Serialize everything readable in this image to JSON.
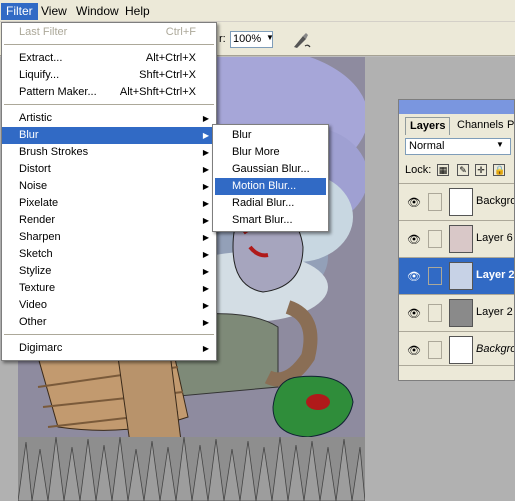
{
  "menubar": {
    "items": [
      {
        "label": "Filter",
        "active": true
      },
      {
        "label": "View"
      },
      {
        "label": "Window"
      },
      {
        "label": "Help"
      }
    ]
  },
  "options_bar": {
    "zoom_label": "r:",
    "zoom_value": "100%",
    "zoom_arrow": "▼"
  },
  "filter_menu": {
    "last_filter": {
      "label": "Last Filter",
      "shortcut": "Ctrl+F"
    },
    "group1": [
      {
        "label": "Extract...",
        "shortcut": "Alt+Ctrl+X"
      },
      {
        "label": "Liquify...",
        "shortcut": "Shft+Ctrl+X"
      },
      {
        "label": "Pattern Maker...",
        "shortcut": "Alt+Shft+Ctrl+X"
      }
    ],
    "categories": [
      {
        "label": "Artistic",
        "arrow": "▶"
      },
      {
        "label": "Blur",
        "arrow": "▶"
      },
      {
        "label": "Brush Strokes",
        "arrow": "▶"
      },
      {
        "label": "Distort",
        "arrow": "▶"
      },
      {
        "label": "Noise",
        "arrow": "▶"
      },
      {
        "label": "Pixelate",
        "arrow": "▶"
      },
      {
        "label": "Render",
        "arrow": "▶"
      },
      {
        "label": "Sharpen",
        "arrow": "▶"
      },
      {
        "label": "Sketch",
        "arrow": "▶"
      },
      {
        "label": "Stylize",
        "arrow": "▶"
      },
      {
        "label": "Texture",
        "arrow": "▶"
      },
      {
        "label": "Video",
        "arrow": "▶"
      },
      {
        "label": "Other",
        "arrow": "▶"
      }
    ],
    "plugins": [
      {
        "label": "Digimarc",
        "arrow": "▶"
      }
    ],
    "highlighted": "Blur"
  },
  "blur_submenu": {
    "items": [
      "Blur",
      "Blur More",
      "Gaussian Blur...",
      "Motion Blur...",
      "Radial Blur...",
      "Smart Blur..."
    ],
    "highlighted": "Motion Blur..."
  },
  "layers_panel": {
    "tabs": [
      "Layers",
      "Channels",
      "Pa"
    ],
    "blend_mode": "Normal",
    "blend_arrow": "▼",
    "lock_label": "Lock:",
    "lock_icons": [
      "▦",
      "✎",
      "✛",
      "🔒"
    ],
    "layers": [
      {
        "name": "Backgrou",
        "eye": "👁",
        "selected": false,
        "italic": false
      },
      {
        "name": "Layer 6",
        "eye": "👁",
        "selected": false,
        "italic": false
      },
      {
        "name": "Layer 2",
        "eye": "👁",
        "selected": true,
        "italic": false
      },
      {
        "name": "Layer 2",
        "eye": "👁",
        "selected": false,
        "italic": false
      },
      {
        "name": "Backgrou",
        "eye": "👁",
        "selected": false,
        "italic": true
      }
    ]
  },
  "colors": {
    "highlight": "#316ac5",
    "menu_bg": "#ece9d8"
  }
}
